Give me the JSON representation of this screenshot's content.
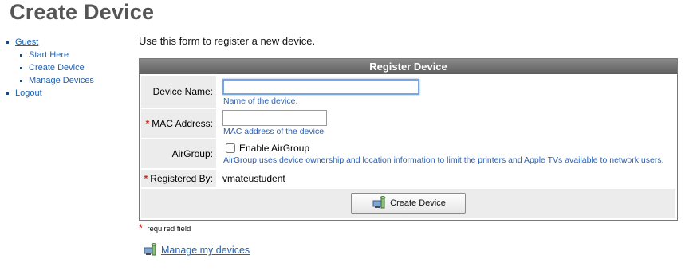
{
  "page": {
    "title": "Create Device"
  },
  "nav": {
    "guest": "Guest",
    "children": [
      "Start Here",
      "Create Device",
      "Manage Devices"
    ],
    "logout": "Logout"
  },
  "intro": "Use this form to register a new device.",
  "form": {
    "header": "Register Device",
    "device_name": {
      "label": "Device Name:",
      "value": "",
      "hint": "Name of the device."
    },
    "mac_address": {
      "label": "MAC Address:",
      "value": "",
      "hint": "MAC address of the device."
    },
    "airgroup": {
      "label": "AirGroup:",
      "checkbox_label": "Enable AirGroup",
      "checked": false,
      "hint": "AirGroup uses device ownership and location information to limit the printers and Apple TVs available to network users."
    },
    "registered_by": {
      "label": "Registered By:",
      "value": "vmateustudent"
    },
    "submit_label": "Create Device",
    "required_marker": "*"
  },
  "required_note": "required field",
  "manage_link": "Manage my devices",
  "colors": {
    "link": "#2261b0",
    "hint": "#2a62b8",
    "required": "#d02a1a",
    "header_bg": "#6e6e6e"
  }
}
